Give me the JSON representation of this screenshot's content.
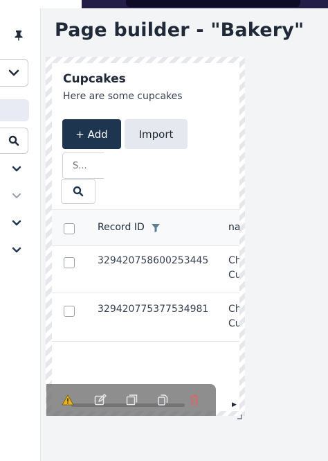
{
  "page": {
    "title": "Page builder - \"Bakery\""
  },
  "component": {
    "title": "Cupcakes",
    "subtitle": "Here are some cupcakes",
    "add_label": "+ Add",
    "import_label": "Import",
    "search_placeholder": "S..."
  },
  "table": {
    "columns": [
      "Record ID",
      "na"
    ],
    "rows": [
      {
        "id": "329420758600253445",
        "name_line1": "Ch",
        "name_line2": "Cu"
      },
      {
        "id": "329420775377534981",
        "name_line1": "Ch",
        "name_line2": "Cu"
      }
    ]
  },
  "icons": {
    "sidebar": [
      "pin-icon",
      "chevron-down-icon",
      "search-icon",
      "chevron-down-icon",
      "chevron-down-icon",
      "chevron-down-icon",
      "chevron-down-icon"
    ],
    "toolbar": [
      "warning-icon",
      "edit-icon",
      "duplicate-icon",
      "copy-icon",
      "trash-icon"
    ],
    "filter": "filter-icon"
  },
  "colors": {
    "primary": "#1e3550",
    "secondary": "#e5e8ee",
    "warning": "#e6b422",
    "danger": "#d46a6a",
    "filter": "#5b7f95",
    "topbar": "#231d47"
  }
}
